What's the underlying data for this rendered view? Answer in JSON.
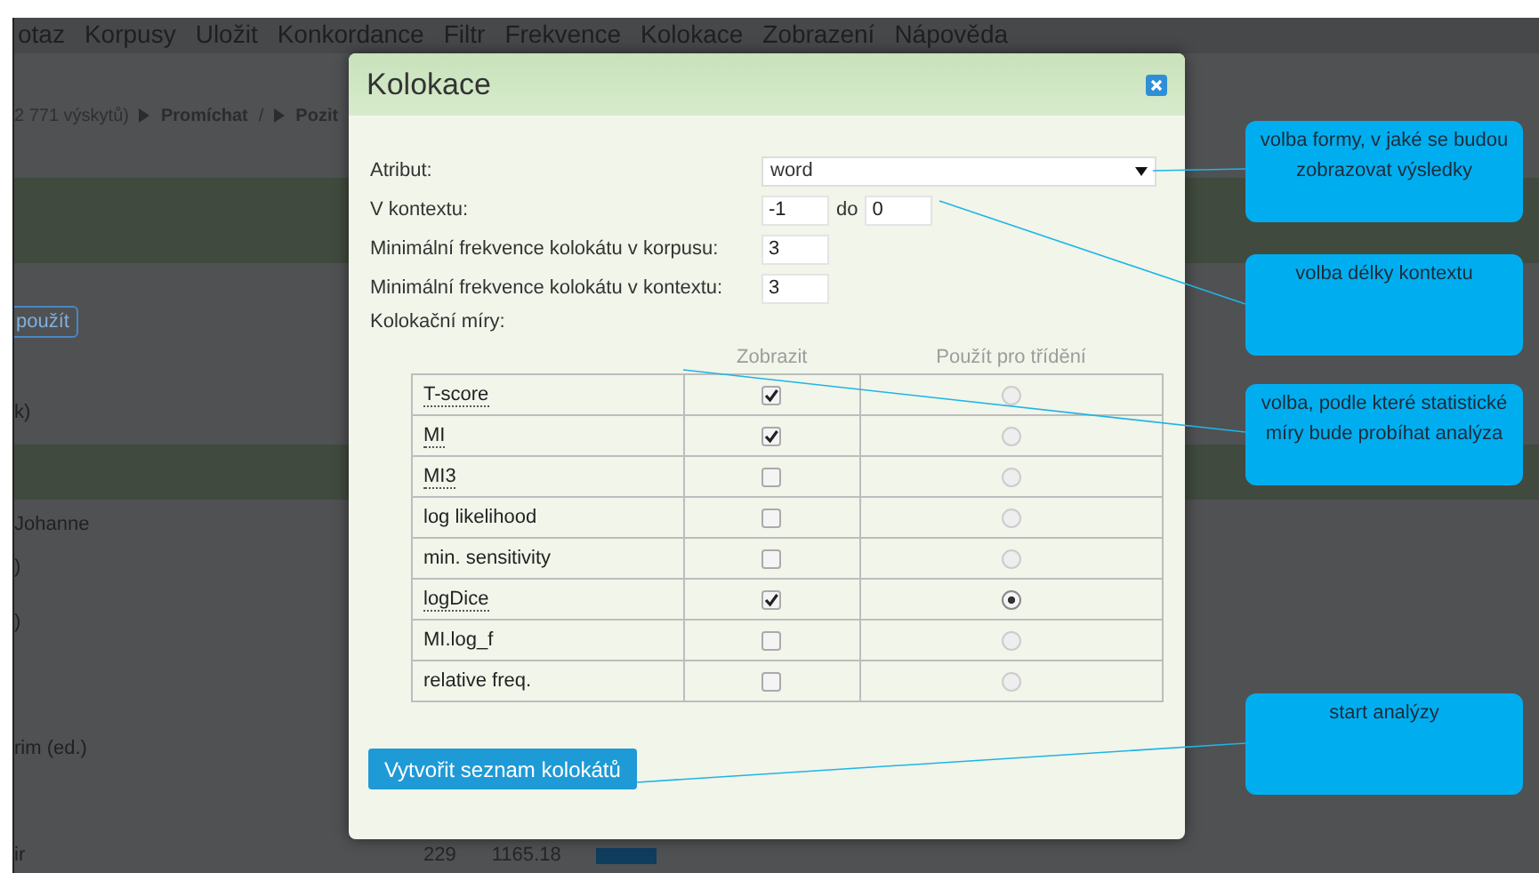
{
  "menu": [
    "otaz",
    "Korpusy",
    "Uložit",
    "Konkordance",
    "Filtr",
    "Frekvence",
    "Kolokace",
    "Zobrazení",
    "Nápověda"
  ],
  "breadcrumb": {
    "count": "2 771 výskytů)",
    "actions": [
      {
        "label": "Promíchat"
      },
      {
        "label": "Pozit"
      }
    ],
    "separator": "/"
  },
  "background_rows": [
    {
      "kind": "band"
    },
    {
      "kind": "button",
      "text": "použít"
    },
    {
      "kind": "text",
      "text": "k)"
    },
    {
      "kind": "band"
    },
    {
      "kind": "text",
      "text": "Johanne"
    },
    {
      "kind": "text",
      "text": ")"
    },
    {
      "kind": "text",
      "text": ")"
    },
    {
      "kind": "text",
      "text": "rim (ed.)"
    },
    {
      "kind": "stat",
      "text": "ir",
      "count": "229",
      "score": "1165.18"
    }
  ],
  "dialog": {
    "title": "Kolokace",
    "fields": [
      {
        "kind": "select",
        "label": "Atribut:",
        "value": "word"
      },
      {
        "kind": "range",
        "label": "V kontextu:",
        "from": "-1",
        "joiner": "do",
        "to": "0"
      },
      {
        "kind": "input",
        "label": "Minimální frekvence kolokátu v korpusu:",
        "value": "3"
      },
      {
        "kind": "input",
        "label": "Minimální frekvence kolokátu v kontextu:",
        "value": "3"
      }
    ],
    "measures_label": "Kolokační míry:",
    "columns": [
      "Zobrazit",
      "Použít pro třídění"
    ],
    "measures": [
      {
        "name": "T-score",
        "has_help": true,
        "checked": true,
        "selected": false
      },
      {
        "name": "MI",
        "has_help": true,
        "checked": true,
        "selected": false
      },
      {
        "name": "MI3",
        "has_help": true,
        "checked": false,
        "selected": false
      },
      {
        "name": "log likelihood",
        "has_help": false,
        "checked": false,
        "selected": false
      },
      {
        "name": "min. sensitivity",
        "has_help": false,
        "checked": false,
        "selected": false
      },
      {
        "name": "logDice",
        "has_help": true,
        "checked": true,
        "selected": true
      },
      {
        "name": "MI.log_f",
        "has_help": false,
        "checked": false,
        "selected": false
      },
      {
        "name": "relative freq.",
        "has_help": false,
        "checked": false,
        "selected": false
      }
    ],
    "submit": "Vytvořit seznam kolokátů"
  },
  "callouts": [
    {
      "text": "volba formy, v jaké se budou zobrazovat výsledky"
    },
    {
      "text": "volba délky kontextu"
    },
    {
      "text": "volba, podle které statistické míry bude probíhat analýza"
    },
    {
      "text": "start analýzy"
    }
  ]
}
